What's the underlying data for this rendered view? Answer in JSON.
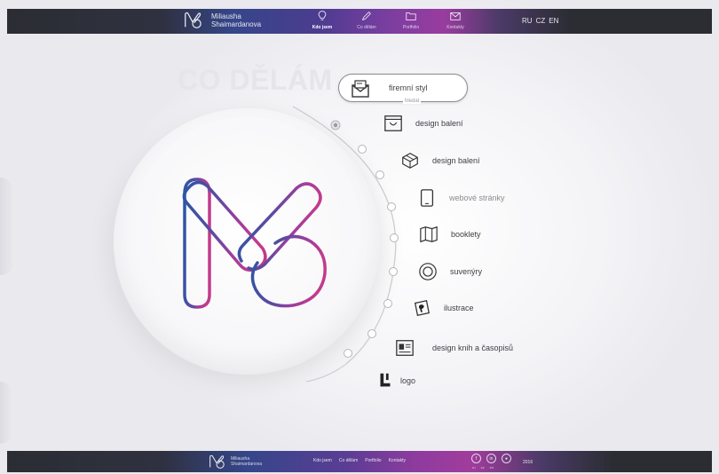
{
  "brand": {
    "name_line1": "Miliausha",
    "name_line2": "Shaimardanova"
  },
  "nav": {
    "items": [
      {
        "label": "Kdo jsem",
        "icon": "lightbulb-icon"
      },
      {
        "label": "Co dělám",
        "icon": "pencil-icon"
      },
      {
        "label": "Portfolio",
        "icon": "folder-icon"
      },
      {
        "label": "Kontakty",
        "icon": "envelope-icon"
      }
    ],
    "active_index": 0
  },
  "languages": [
    "RU",
    "CZ",
    "EN"
  ],
  "page": {
    "heading": "CO DĚLÁM"
  },
  "services": {
    "selected": {
      "label": "firemní styl",
      "sub": "hledat",
      "icon": "envelope-letter-icon"
    },
    "items": [
      {
        "label": "design balení",
        "icon": "shopping-box-icon"
      },
      {
        "label": "design balení",
        "icon": "package-box-icon"
      },
      {
        "label": "webové stránky",
        "icon": "tablet-icon"
      },
      {
        "label": "booklety",
        "icon": "map-booklet-icon"
      },
      {
        "label": "suvenýry",
        "icon": "badge-circle-icon"
      },
      {
        "label": "ilustrace",
        "icon": "picture-card-icon"
      },
      {
        "label": "design knih a časopisů",
        "icon": "newspaper-icon"
      },
      {
        "label": "logo",
        "icon": "logo-mark-icon"
      }
    ]
  },
  "footer": {
    "brand_line1": "Miliausha",
    "brand_line2": "Shaimardanova",
    "nav": [
      "Kdo jsem",
      "Co dělám",
      "Portfolio",
      "Kontakty"
    ],
    "social": [
      {
        "icon": "facebook-icon",
        "glyph": "f"
      },
      {
        "icon": "linkedin-icon",
        "glyph": "in"
      },
      {
        "icon": "behance-icon",
        "glyph": "●"
      }
    ],
    "langs": [
      "ru",
      "cz",
      "en"
    ],
    "year": "2016"
  },
  "colors": {
    "accent_blue": "#2f5aa8",
    "accent_purple": "#a43c9c",
    "accent_pink": "#c23a8c",
    "bar_dark": "#2b2d33"
  }
}
